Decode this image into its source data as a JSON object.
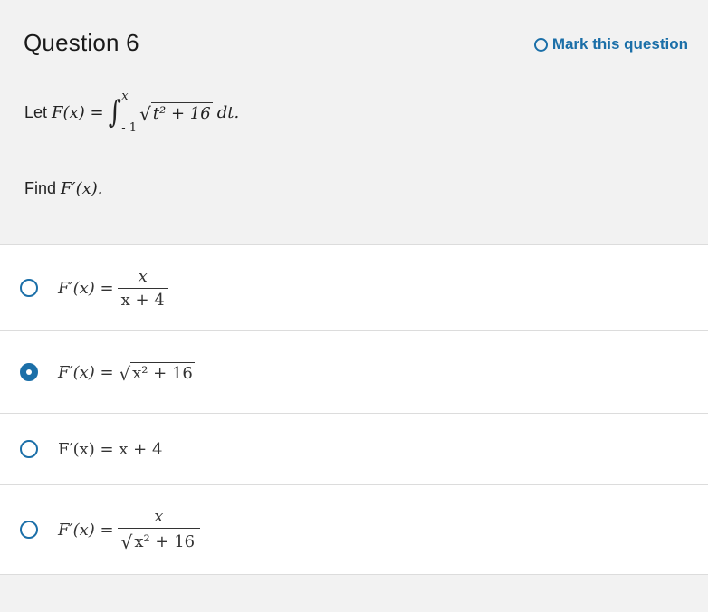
{
  "question": {
    "title": "Question 6",
    "mark_label": "Mark this question",
    "prompt_prefix": "Let",
    "function_name": "F(x) =",
    "integral_upper": "x",
    "integral_lower": "- 1",
    "integrand": "t² + 16",
    "differential": "dt.",
    "find_prefix": "Find",
    "find_expr": "F′(x)."
  },
  "options": [
    {
      "lhs": "F′(x) =",
      "numerator": "x",
      "denominator": "x + 4",
      "selected": false
    },
    {
      "lhs": "F′(x) =",
      "radicand": "x² + 16",
      "selected": true
    },
    {
      "lhs": "F′(x) = x + 4",
      "selected": false
    },
    {
      "lhs": "F′(x) =",
      "numerator": "x",
      "denominator_radicand": "x² + 16",
      "selected": false
    }
  ],
  "colors": {
    "accent": "#1b6fa8",
    "panel_bg": "#f2f2f2",
    "options_bg": "#ffffff"
  }
}
